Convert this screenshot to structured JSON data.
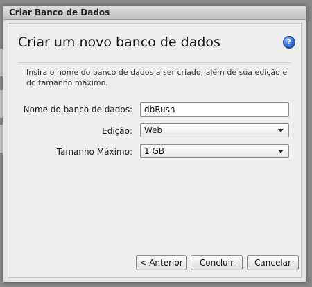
{
  "dialog": {
    "title": "Criar Banco de Dados",
    "heading": "Criar um novo banco de dados",
    "help_icon": "question-circle-icon",
    "instructions": "Insira o nome do banco de dados a ser criado, além de sua edição e do tamanho máximo."
  },
  "form": {
    "name_label": "Nome do banco de dados:",
    "name_value": "dbRush",
    "edition_label": "Edição:",
    "edition_value": "Web",
    "max_size_label": "Tamanho Máximo:",
    "max_size_value": "1 GB"
  },
  "buttons": {
    "back": "< Anterior",
    "finish": "Concluir",
    "cancel": "Cancelar"
  },
  "colors": {
    "overlay": "#8a8a8a",
    "dialog_bg": "#efefef",
    "help_accent": "#1f59c9"
  }
}
